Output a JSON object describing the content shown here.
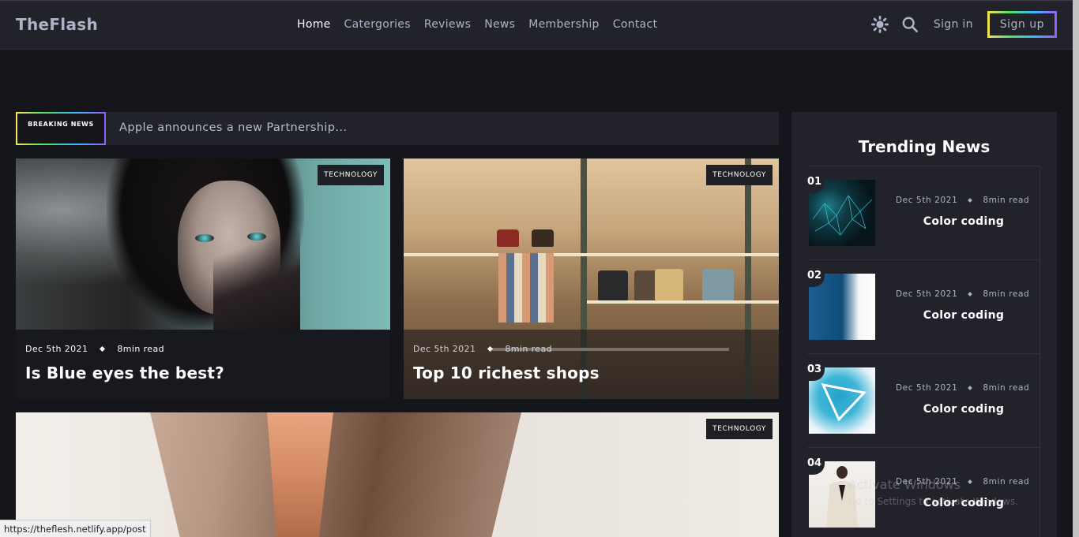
{
  "header": {
    "logo": "TheFlash",
    "nav": [
      "Home",
      "Catergories",
      "Reviews",
      "News",
      "Membership",
      "Contact"
    ],
    "signin": "Sign in",
    "signup": "Sign up"
  },
  "breaking": {
    "label": "BREAKING NEWS",
    "text": "Apple announces a new Partnership..."
  },
  "cards": [
    {
      "tag": "TECHNOLOGY",
      "date": "Dec 5th 2021",
      "read": "8min read",
      "title": "Is Blue eyes the best?"
    },
    {
      "tag": "TECHNOLOGY",
      "date": "Dec 5th 2021",
      "read": "8min read",
      "title": "Top 10 richest shops"
    },
    {
      "tag": "TECHNOLOGY"
    }
  ],
  "trending": {
    "title": "Trending News",
    "items": [
      {
        "num": "01",
        "date": "Dec 5th 2021",
        "read": "8min read",
        "title": "Color coding"
      },
      {
        "num": "02",
        "date": "Dec 5th 2021",
        "read": "8min read",
        "title": "Color coding"
      },
      {
        "num": "03",
        "date": "Dec 5th 2021",
        "read": "8min read",
        "title": "Color coding"
      },
      {
        "num": "04",
        "date": "Dec 5th 2021",
        "read": "8min read",
        "title": "Color coding"
      }
    ]
  },
  "overlay": {
    "watermark_title": "Activate Windows",
    "watermark_sub": "Go to Settings to activate Windows.",
    "status_url": "https://theflesh.netlify.app/post"
  },
  "icons": {
    "theme": "sun-icon",
    "search": "search-icon"
  },
  "colors": {
    "accent_gradient": [
      "#f9e64b",
      "#4fe06b",
      "#3ab8ff",
      "#9b5bff"
    ],
    "header_bg": "#22232a",
    "page_bg": "#15161b"
  }
}
